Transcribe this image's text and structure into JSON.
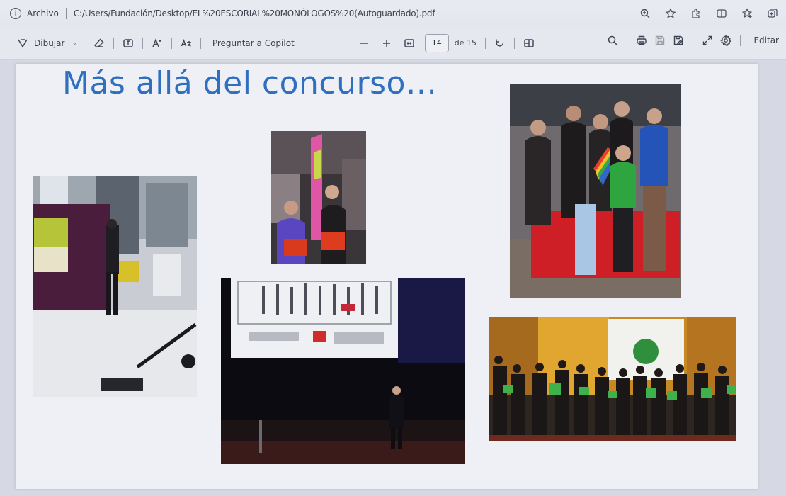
{
  "titlebar": {
    "file_menu": "Archivo",
    "path": "C:/Users/Fundación/Desktop/EL%20ESCORIAL%20MONÓLOGOS%20(Autoguardado).pdf"
  },
  "toolbar": {
    "draw_label": "Dibujar",
    "copilot_label": "Preguntar a Copilot",
    "page_number": "14",
    "page_total": "de 15",
    "edit_label": "Editar"
  },
  "slide": {
    "title": "Más allá del concurso…"
  },
  "icons": {
    "info": "info-icon",
    "draw": "draw-icon",
    "eraser": "eraser-icon",
    "text": "text-box-icon",
    "read_aloud": "read-aloud-icon",
    "translate": "translate-icon",
    "zoom_out": "minus-icon",
    "zoom_in": "plus-icon",
    "fit_page": "fit-page-icon",
    "rotate": "rotate-icon",
    "page_view": "page-view-icon",
    "search": "search-icon",
    "print": "print-icon",
    "save": "save-icon",
    "save_as": "save-as-icon",
    "fullscreen": "expand-icon",
    "settings": "gear-icon",
    "favorite": "star-icon",
    "extensions": "puzzle-icon",
    "split": "split-screen-icon",
    "favorites_bar": "favorites-icon",
    "collections": "collections-icon",
    "zoom": "zoom-icon"
  },
  "colors": {
    "title_blue": "#2f6fc0",
    "page_bg": "#eef0f6",
    "chrome_bg": "#e6e8ef"
  }
}
